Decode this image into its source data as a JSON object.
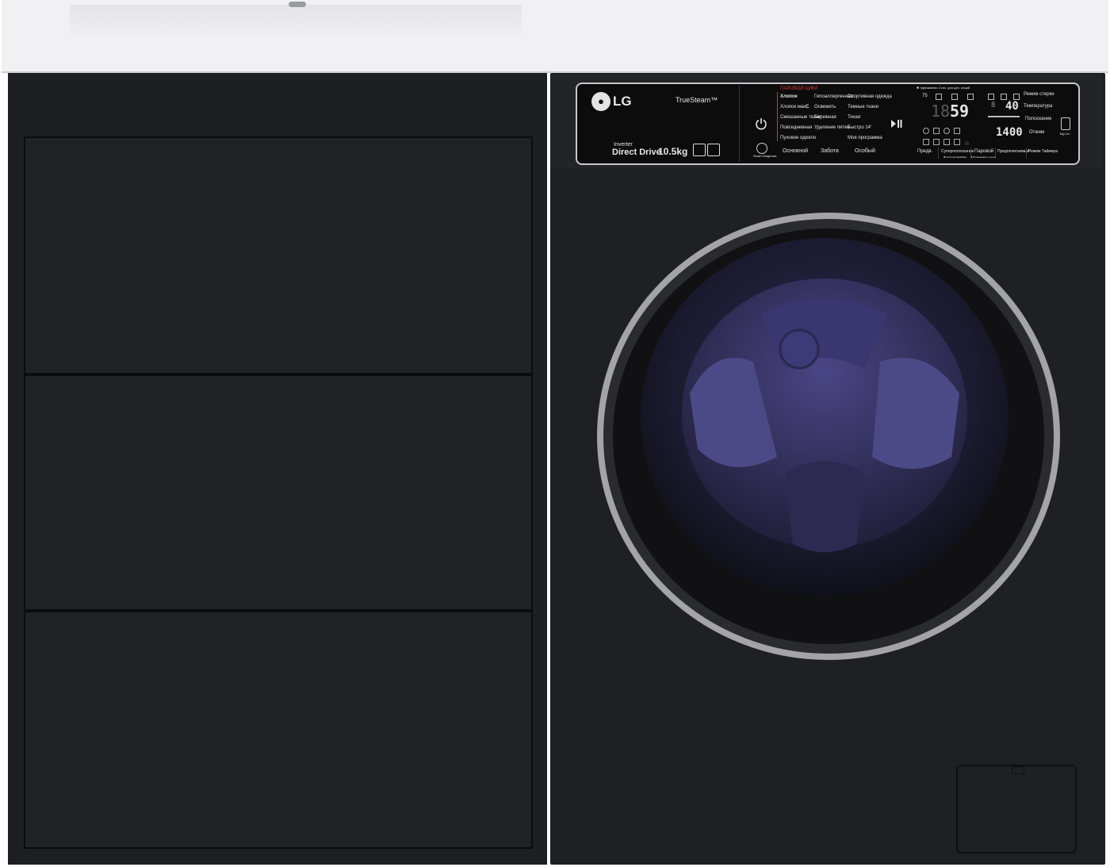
{
  "panel": {
    "brand": "LG",
    "truesteam": "TrueSteam™",
    "inverter": "Inverter",
    "direct_drive": "Direct Drive",
    "capacity": "10.5kg",
    "steam_cycles_header": "ПАРОВОЙ ЦИКЛ",
    "program_col1": [
      "Хлопок",
      "Хлопок макс.",
      "Смешанные ткани",
      "Повседневная",
      "Пуховое одеяло"
    ],
    "program_col2": [
      "Гипоаллергенная",
      "Освежить",
      "Бережная",
      "Удаление пятен"
    ],
    "program_col3": [
      "Спортивная одежда",
      "Темные ткани",
      "Тихая",
      "Быстро 14'",
      "Моя программа"
    ],
    "group_labels": [
      "Основной",
      "Забота",
      "Особый"
    ],
    "note": "✱ Удерживать 3 сек. для доп. опций",
    "display_time": "59",
    "display_temp": "40",
    "display_spin": "1400",
    "display_rinse_count": "75",
    "right_labels": [
      "Режим стирки",
      "Температура",
      "Полоскание",
      "Отжим"
    ],
    "bottom_buttons": [
      "Предв.",
      "Суперполоскание",
      "Паровой",
      "Предпочитаемый",
      "Режим Таймера"
    ],
    "bottom_sublabels": [
      "✱ Очистка барабана",
      "✱ Блокировка от детей"
    ],
    "smart_diagnosis": "Smart Diagnosis",
    "tag_on": "Tag On",
    "small_cycle_temp_mark": "C"
  },
  "colors": {
    "body": "#1f2023",
    "panel": "#0c0c0d",
    "drum_glow": "#3a3670",
    "door_ring": "#9a9aa0",
    "counter": "#f1f1f3",
    "accent_red": "#d23a3a"
  }
}
